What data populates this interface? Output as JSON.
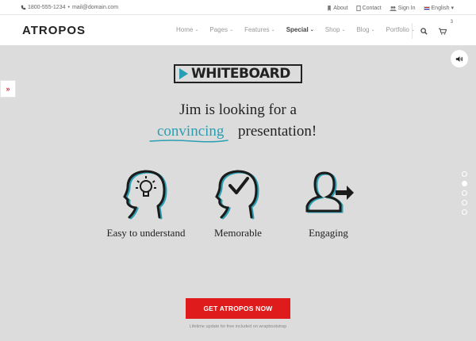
{
  "topbar": {
    "phone": "1800-555-1234",
    "separator": "•",
    "email": "mail@domain.com",
    "about": "About",
    "contact": "Contact",
    "signin": "Sign In",
    "language": "English",
    "language_chevron": "▾"
  },
  "navbar": {
    "logo": "ATROPOS",
    "menu": [
      {
        "label": "Home",
        "chevron": "⌄"
      },
      {
        "label": "Pages",
        "chevron": "⌄"
      },
      {
        "label": "Features",
        "chevron": "⌄"
      },
      {
        "label": "Special",
        "chevron": "⌄"
      },
      {
        "label": "Shop",
        "chevron": "⌄"
      },
      {
        "label": "Blog",
        "chevron": "⌄"
      },
      {
        "label": "Portfolio",
        "chevron": "⌄"
      }
    ],
    "cart_count": "3"
  },
  "hero": {
    "side_tab": "»",
    "brand_label": "WHITEBOARD",
    "line1": "Jim is looking for a",
    "highlight": "convincing",
    "line2_rest": "presentation!",
    "features": [
      {
        "label": "Easy to understand",
        "icon": "head-lightbulb-icon"
      },
      {
        "label": "Memorable",
        "icon": "head-checkmark-icon"
      },
      {
        "label": "Engaging",
        "icon": "person-arrow-icon"
      }
    ],
    "cta_label": "GET ATROPOS NOW",
    "cta_note": "Lifetime update for free included on wrapbootstrap",
    "slider_dots": 5,
    "active_dot": 2
  },
  "colors": {
    "accent": "#2a9fb3",
    "cta": "#e01b1b",
    "hero_bg": "#dcdcdc"
  }
}
